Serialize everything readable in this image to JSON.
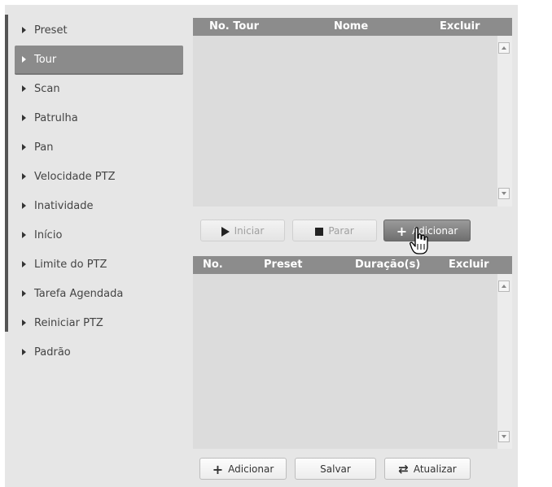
{
  "sidebar": {
    "items": [
      {
        "label": "Preset"
      },
      {
        "label": "Tour",
        "active": true
      },
      {
        "label": "Scan"
      },
      {
        "label": "Patrulha"
      },
      {
        "label": "Pan"
      },
      {
        "label": "Velocidade PTZ"
      },
      {
        "label": "Inatividade"
      },
      {
        "label": "Início"
      },
      {
        "label": "Limite do PTZ"
      },
      {
        "label": "Tarefa Agendada"
      },
      {
        "label": "Reiniciar PTZ"
      },
      {
        "label": "Padrão"
      }
    ]
  },
  "tour_table": {
    "columns": [
      "No. Tour",
      "Nome",
      "Excluir"
    ],
    "rows": []
  },
  "tour_actions": {
    "start_label": "Iniciar",
    "stop_label": "Parar",
    "add_label": "Adicionar"
  },
  "preset_table": {
    "columns": [
      "No.",
      "Preset",
      "Duração(s)",
      "Excluir"
    ],
    "rows": []
  },
  "footer_actions": {
    "add_label": "Adicionar",
    "save_label": "Salvar",
    "refresh_label": "Atualizar"
  },
  "icons": {
    "start": "play-icon",
    "stop": "stop-icon",
    "add": "plus-icon",
    "refresh": "refresh-icon",
    "cursor": "hand-cursor-icon"
  },
  "colors": {
    "header_bg": "#8c8c8c",
    "active_item_bg": "#8b8b8b",
    "panel_bg": "#e6e6e6",
    "table_bg": "#dcdcdc"
  }
}
